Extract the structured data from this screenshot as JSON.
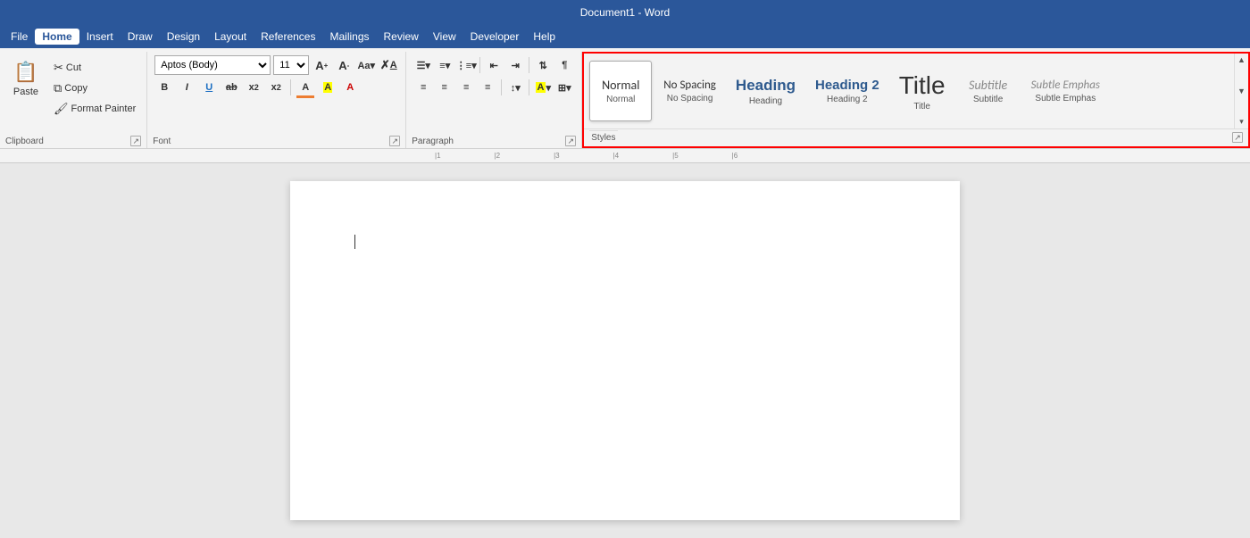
{
  "titleBar": {
    "text": "Document1 - Word"
  },
  "menuBar": {
    "items": [
      {
        "label": "File",
        "active": false
      },
      {
        "label": "Home",
        "active": true
      },
      {
        "label": "Insert",
        "active": false
      },
      {
        "label": "Draw",
        "active": false
      },
      {
        "label": "Design",
        "active": false
      },
      {
        "label": "Layout",
        "active": false
      },
      {
        "label": "References",
        "active": false
      },
      {
        "label": "Mailings",
        "active": false
      },
      {
        "label": "Review",
        "active": false
      },
      {
        "label": "View",
        "active": false
      },
      {
        "label": "Developer",
        "active": false
      },
      {
        "label": "Help",
        "active": false
      }
    ]
  },
  "ribbon": {
    "clipboard": {
      "paste_label": "Paste",
      "cut_label": "Cut",
      "copy_label": "Copy",
      "format_painter_label": "Format Painter",
      "group_label": "Clipboard"
    },
    "font": {
      "font_name": "Aptos (Body)",
      "font_size": "11",
      "bold_label": "B",
      "italic_label": "I",
      "underline_label": "U",
      "strikethrough_label": "ab",
      "subscript_label": "x₂",
      "superscript_label": "x²",
      "font_color_label": "A",
      "highlight_label": "A",
      "clear_label": "A",
      "group_label": "Font"
    },
    "paragraph": {
      "group_label": "Paragraph"
    },
    "styles": {
      "group_label": "Styles",
      "items": [
        {
          "label": "Normal",
          "preview": "Normal",
          "active": true
        },
        {
          "label": "No Spacing",
          "preview": "No Spacing"
        },
        {
          "label": "Heading",
          "preview": "Heading"
        },
        {
          "label": "Heading 2",
          "preview": "Heading 2"
        },
        {
          "label": "Title",
          "preview": "Title"
        },
        {
          "label": "Subtitle",
          "preview": "Subtitle"
        },
        {
          "label": "Subtle Emphas",
          "preview": "Subtle Emphas"
        }
      ]
    }
  },
  "ruler": {
    "marks": [
      "1",
      "2",
      "3",
      "4",
      "5",
      "6"
    ]
  },
  "document": {
    "cursor_visible": true
  }
}
